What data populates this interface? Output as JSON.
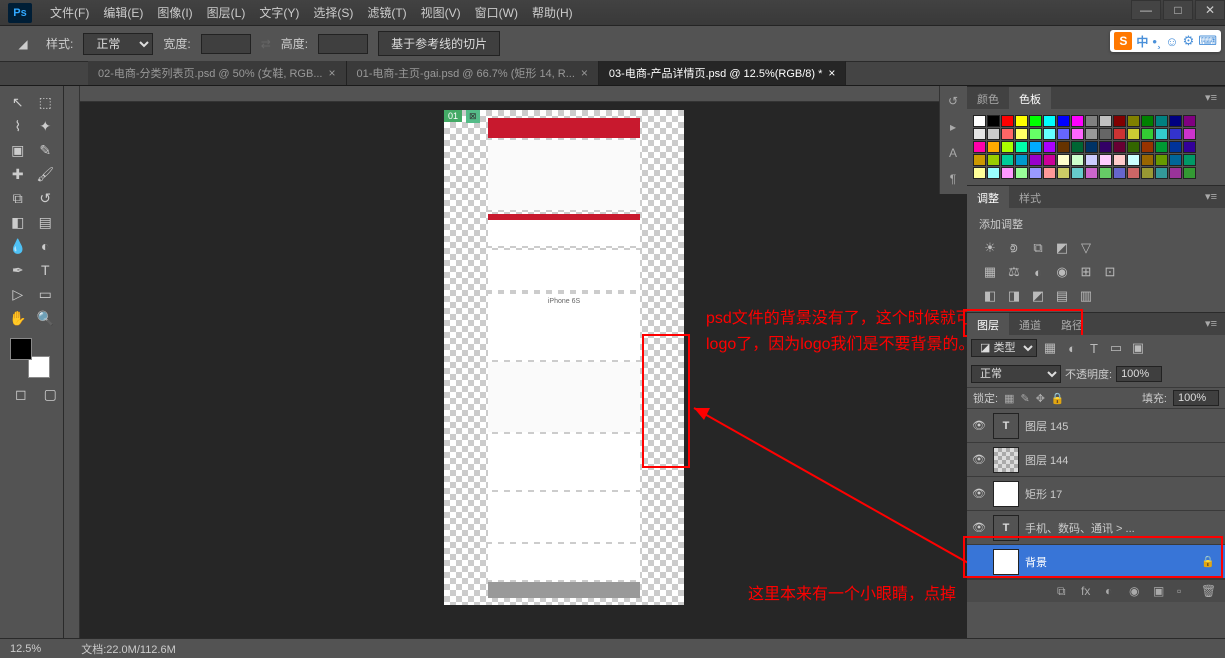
{
  "titlebar": {
    "app": "Ps"
  },
  "window": {
    "min": "—",
    "max": "□",
    "close": "✕"
  },
  "menu": [
    {
      "label": "文件(F)",
      "k": "file"
    },
    {
      "label": "编辑(E)",
      "k": "edit"
    },
    {
      "label": "图像(I)",
      "k": "image"
    },
    {
      "label": "图层(L)",
      "k": "layer"
    },
    {
      "label": "文字(Y)",
      "k": "type"
    },
    {
      "label": "选择(S)",
      "k": "select"
    },
    {
      "label": "滤镜(T)",
      "k": "filter"
    },
    {
      "label": "视图(V)",
      "k": "view"
    },
    {
      "label": "窗口(W)",
      "k": "window"
    },
    {
      "label": "帮助(H)",
      "k": "help"
    }
  ],
  "options": {
    "style_label": "样式:",
    "style_value": "正常",
    "width_label": "宽度:",
    "height_label": "高度:",
    "slice_btn": "基于参考线的切片"
  },
  "tabs": [
    {
      "label": "02-电商-分类列表页.psd @ 50% (女鞋, RGB...",
      "active": false
    },
    {
      "label": "01-电商-主页-gai.psd @ 66.7% (矩形 14, R...",
      "active": false
    },
    {
      "label": "03-电商-产品详情页.psd @ 12.5%(RGB/8) *",
      "active": true
    }
  ],
  "tools": [
    [
      "move",
      "marquee"
    ],
    [
      "lasso",
      "quick-select"
    ],
    [
      "crop",
      "eyedropper"
    ],
    [
      "healing",
      "brush"
    ],
    [
      "clone",
      "history-brush"
    ],
    [
      "eraser",
      "gradient"
    ],
    [
      "blur",
      "dodge"
    ],
    [
      "pen",
      "type"
    ],
    [
      "path-select",
      "rectangle"
    ],
    [
      "hand",
      "zoom"
    ]
  ],
  "tool_glyphs": {
    "move": "↖",
    "marquee": "⬚",
    "lasso": "⌇",
    "quick-select": "✦",
    "crop": "▣",
    "eyedropper": "✎",
    "healing": "✚",
    "brush": "🖌",
    "clone": "⧉",
    "history-brush": "↺",
    "eraser": "◧",
    "gradient": "▤",
    "blur": "💧",
    "dodge": "◐",
    "pen": "✒",
    "type": "T",
    "path-select": "▷",
    "rectangle": "▭",
    "hand": "✋",
    "zoom": "🔍"
  },
  "mini_icons": [
    "quickmask",
    "screenmode"
  ],
  "slice": {
    "num": "01",
    "icon": "⊠"
  },
  "anno1": "psd文件的背景没有了，这个时候就可以去切logo了，因为logo我们是不要背景的。",
  "anno2": "这里本来有一个小眼睛，点掉",
  "panels": {
    "color": {
      "tabs": [
        "颜色",
        "色板"
      ],
      "active": 1
    },
    "adjust": {
      "tabs": [
        "调整",
        "样式"
      ],
      "active": 0,
      "title": "添加调整"
    },
    "layers": {
      "tabs": [
        "图层",
        "通道",
        "路径"
      ],
      "active": 0,
      "kind_label": "◪ 类型",
      "blend_value": "正常",
      "opacity_label": "不透明度:",
      "opacity_value": "100%",
      "lock_label": "锁定:",
      "fill_label": "填充:",
      "fill_value": "100%",
      "items": [
        {
          "name": "图层 145",
          "type": "text",
          "visible": true
        },
        {
          "name": "图层 144",
          "type": "chk",
          "visible": true
        },
        {
          "name": "矩形 17",
          "type": "white",
          "visible": true
        },
        {
          "name": "手机、数码、通讯  > ...",
          "type": "text",
          "visible": true
        },
        {
          "name": "背景",
          "type": "white",
          "visible": false,
          "locked": true,
          "selected": true
        }
      ]
    }
  },
  "status": {
    "zoom": "12.5%",
    "doc": "文档:22.0M/112.6M"
  },
  "ime": {
    "s": "S",
    "lang": "中",
    "icons": [
      "•¸",
      "☺",
      "⚙",
      "⌨"
    ]
  },
  "swatch_colors": [
    "#ffffff",
    "#000000",
    "#ff0000",
    "#ffff00",
    "#00ff00",
    "#00ffff",
    "#0000ff",
    "#ff00ff",
    "#808080",
    "#c0c0c0",
    "#800000",
    "#808000",
    "#008000",
    "#008080",
    "#000080",
    "#800080",
    "#e6e6e6",
    "#cccccc",
    "#ff6666",
    "#ffff66",
    "#66ff66",
    "#66ffff",
    "#6666ff",
    "#ff66ff",
    "#999999",
    "#666666",
    "#cc3333",
    "#cccc33",
    "#33cc33",
    "#33cccc",
    "#3333cc",
    "#cc33cc",
    "#f0a",
    "#fa0",
    "#af0",
    "#0fa",
    "#0af",
    "#a0f",
    "#630",
    "#063",
    "#036",
    "#306",
    "#603",
    "#360",
    "#930",
    "#093",
    "#039",
    "#309",
    "#c90",
    "#9c0",
    "#0c9",
    "#09c",
    "#90c",
    "#c09",
    "#ffc",
    "#cfc",
    "#ccf",
    "#fcf",
    "#fcc",
    "#cff",
    "#960",
    "#690",
    "#069",
    "#096",
    "#ff9",
    "#9ff",
    "#f9f",
    "#9f9",
    "#99f",
    "#f99",
    "#cc6",
    "#6cc",
    "#c6c",
    "#6c6",
    "#66c",
    "#c66",
    "#993",
    "#399",
    "#939",
    "#393"
  ]
}
